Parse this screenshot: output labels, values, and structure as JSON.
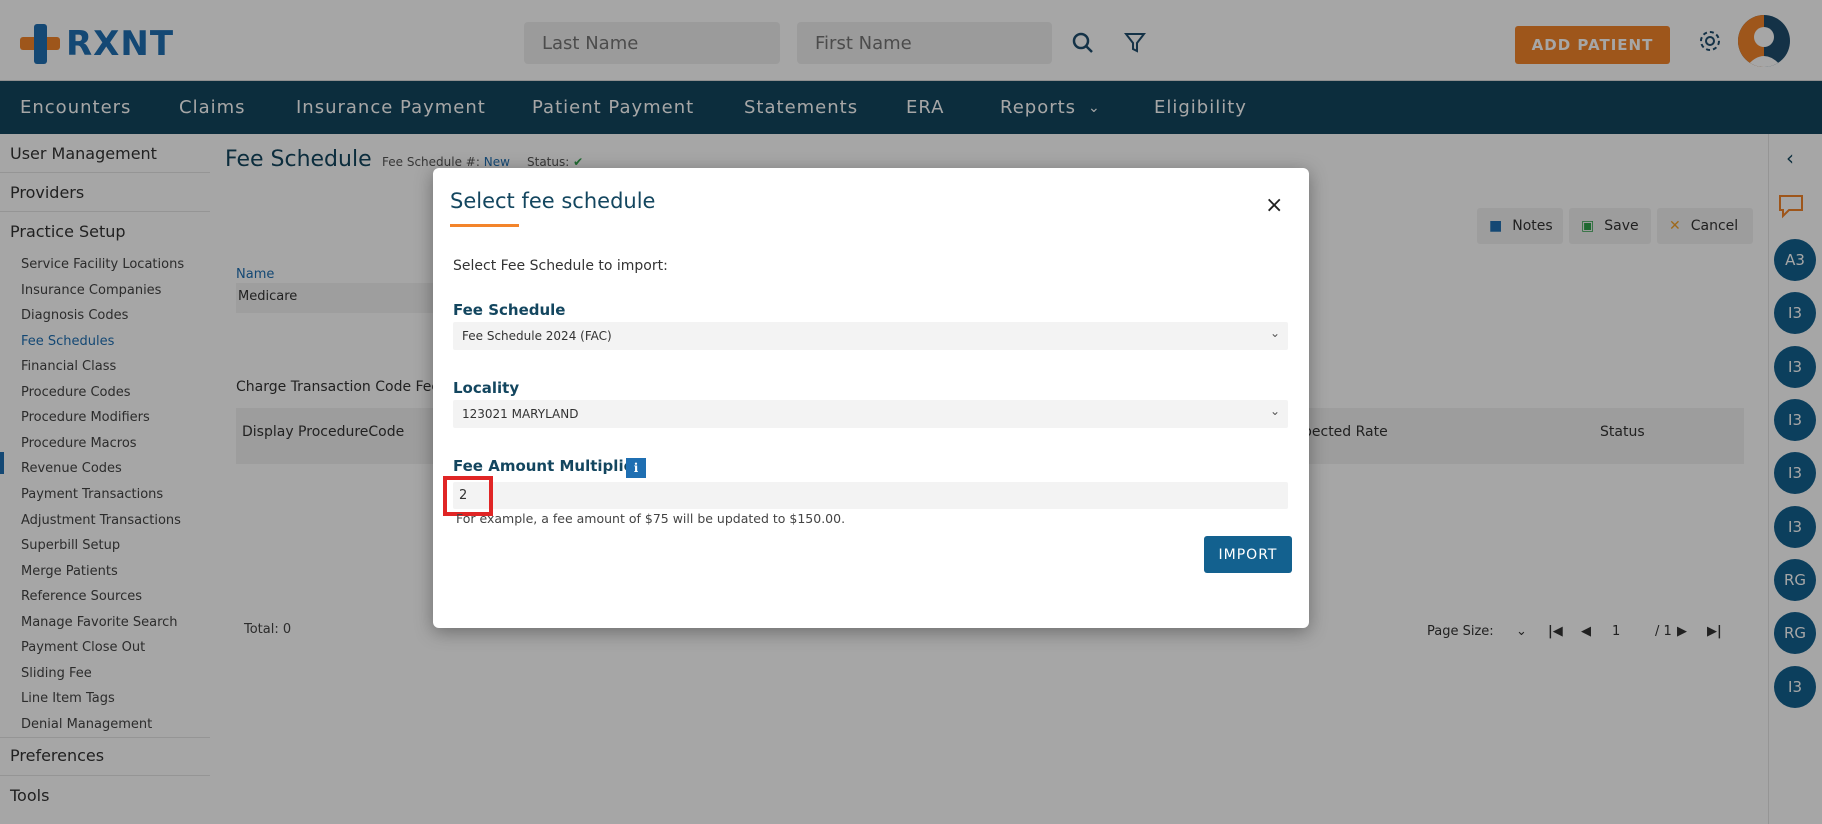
{
  "header": {
    "logo_text": "RXNT",
    "last_name_placeholder": "Last Name",
    "first_name_placeholder": "First Name",
    "add_patient_label": "ADD PATIENT"
  },
  "nav": {
    "items": [
      "Encounters",
      "Claims",
      "Insurance Payment",
      "Patient Payment",
      "Statements",
      "ERA",
      "Reports",
      "Eligibility"
    ]
  },
  "sidebar": {
    "sections": [
      "User Management",
      "Providers",
      "Practice Setup",
      "Preferences",
      "Tools"
    ],
    "practice_setup_items": [
      "Service Facility Locations",
      "Insurance Companies",
      "Diagnosis Codes",
      "Fee Schedules",
      "Financial Class",
      "Procedure Codes",
      "Procedure Modifiers",
      "Procedure Macros",
      "Revenue Codes",
      "Payment Transactions",
      "Adjustment Transactions",
      "Superbill Setup",
      "Merge Patients",
      "Reference Sources",
      "Manage Favorite Search",
      "Payment Close Out",
      "Sliding Fee",
      "Line Item Tags",
      "Denial Management"
    ],
    "active_item": "Fee Schedules"
  },
  "page": {
    "title": "Fee Schedule",
    "meta_label": "Fee Schedule #:",
    "meta_value": "New",
    "status_label": "Status:",
    "toolbar": {
      "notes": "Notes",
      "save": "Save",
      "cancel": "Cancel"
    },
    "name_label": "Name",
    "name_value": "Medicare",
    "section_label": "Charge Transaction Code Fee",
    "columns": [
      "Display ProcedureCode",
      "pected Rate",
      "Status"
    ],
    "total_label": "Total: 0",
    "page_size_label": "Page Size:",
    "page_number": "1",
    "page_total": "/ 1"
  },
  "rail": {
    "badges": [
      "A3",
      "I3",
      "I3",
      "I3",
      "I3",
      "I3",
      "RG",
      "RG",
      "I3"
    ]
  },
  "modal": {
    "title": "Select fee schedule",
    "close_symbol": "×",
    "subtitle": "Select Fee Schedule to import:",
    "fee_schedule_label": "Fee Schedule",
    "fee_schedule_value": "Fee Schedule 2024 (FAC)",
    "locality_label": "Locality",
    "locality_value": "123021 MARYLAND",
    "multiplier_label": "Fee Amount Multiplier",
    "info_symbol": "i",
    "multiplier_value": "2",
    "example_text": "For example, a fee amount of $75 will be updated to $150.00.",
    "import_label": "IMPORT"
  },
  "colors": {
    "brand_blue": "#1f6fb2",
    "brand_orange": "#f3842a",
    "nav_bg": "#13465f",
    "badge_blue": "#13618f",
    "highlight_red": "#e02525"
  }
}
